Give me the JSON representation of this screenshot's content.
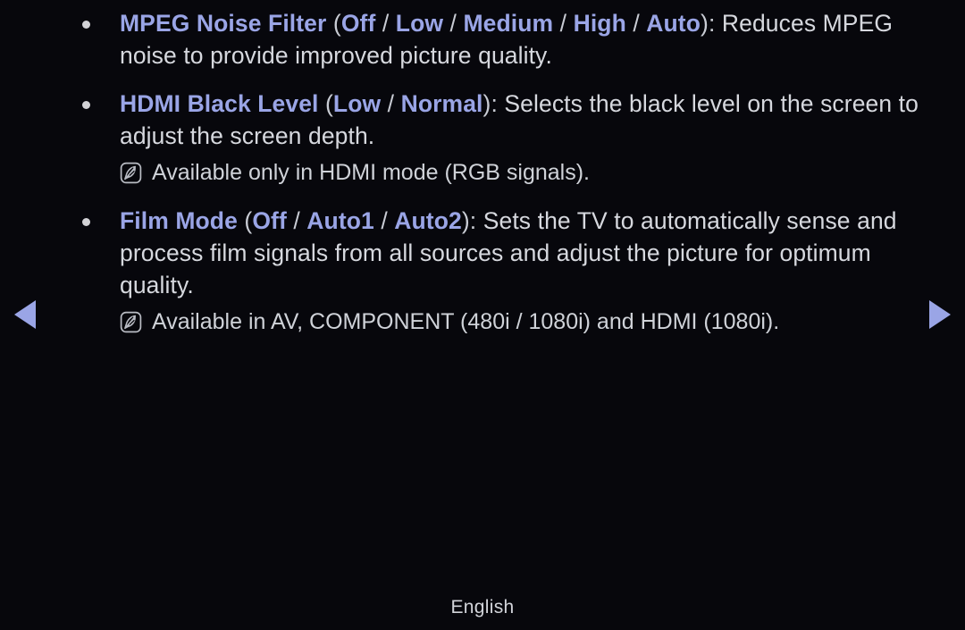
{
  "screen": {
    "background_color": "#07070c",
    "accent_color": "#9aa5e6",
    "body_text_color": "#d6d8de"
  },
  "nav": {
    "prev_icon": "triangle-left-icon",
    "next_icon": "triangle-right-icon"
  },
  "note_icon_name": "note-leaf-icon",
  "items": [
    {
      "bullet": "•",
      "name": "MPEG Noise Filter",
      "open_paren": "(",
      "options": [
        "Off",
        "Low",
        "Medium",
        "High",
        "Auto"
      ],
      "separator": " / ",
      "close_paren": ")",
      "colon": ": ",
      "description": "Reduces MPEG noise to provide improved picture quality."
    },
    {
      "bullet": "•",
      "name": "HDMI Black Level",
      "open_paren": "(",
      "options": [
        "Low",
        "Normal"
      ],
      "separator": " / ",
      "close_paren": ")",
      "colon": ": ",
      "description": "Selects the black level on the screen to adjust the screen depth."
    },
    {
      "bullet": "•",
      "name": "Film Mode",
      "open_paren": "(",
      "options": [
        "Off",
        "Auto1",
        "Auto2"
      ],
      "separator": " / ",
      "close_paren": ")",
      "colon": ": ",
      "description": "Sets the TV to automatically sense and process film signals from all sources and adjust the picture for optimum quality."
    }
  ],
  "notes": {
    "hdmi_black_level": "Available only in HDMI mode (RGB signals).",
    "film_mode": "Available in AV, COMPONENT (480i / 1080i) and HDMI (1080i)."
  },
  "footer": {
    "language": "English"
  }
}
